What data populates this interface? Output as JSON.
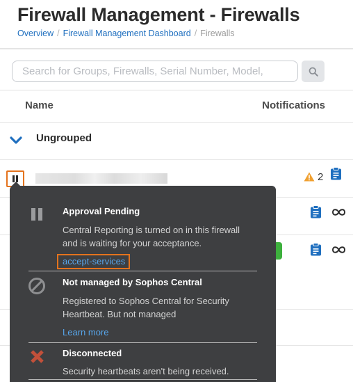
{
  "header": {
    "title": "Firewall Management - Firewalls",
    "breadcrumb": [
      "Overview",
      "Firewall Management Dashboard",
      "Firewalls"
    ]
  },
  "search": {
    "placeholder": "Search for Groups, Firewalls, Serial Number, Model,",
    "value": ""
  },
  "table": {
    "columns": [
      "Name",
      "Notifications"
    ],
    "group": {
      "label": "Ungrouped",
      "expanded": true
    },
    "rows": [
      {
        "status_icon": "pause-icon",
        "name": "",
        "alerts": "2",
        "alert_icon": "warning-icon",
        "notes_icon": "clipboard-icon"
      },
      {
        "notes_icon": "clipboard-icon",
        "link_icon": "infinity-icon"
      },
      {
        "notes_icon": "clipboard-icon",
        "link_icon": "infinity-icon"
      }
    ]
  },
  "tooltip": {
    "items": [
      {
        "icon": "pause-icon",
        "title": "Approval Pending",
        "description": "Central Reporting is turned on in this firewall and is waiting for your acceptance.",
        "link": "accept-services"
      },
      {
        "icon": "no-entry-icon",
        "title": "Not managed by Sophos Central",
        "description": "Registered to Sophos Central for Security Heartbeat. But not managed",
        "link": "Learn more"
      },
      {
        "icon": "x-icon",
        "title": "Disconnected",
        "description": "Security heartbeats aren't being received."
      }
    ]
  },
  "colors": {
    "accent_blue": "#1f6fbf",
    "highlight_orange": "#e4731d",
    "warning_orange": "#f0a030",
    "tooltip_bg": "#3e3f41",
    "error_red": "#c2503a"
  }
}
